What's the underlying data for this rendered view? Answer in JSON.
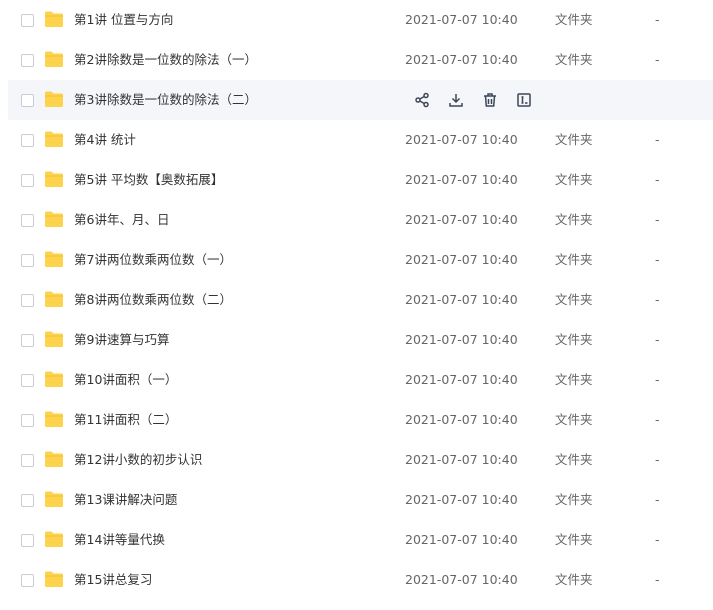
{
  "columns": {
    "type_label": "文件夹",
    "size_label": "-"
  },
  "rows": [
    {
      "name": "第1讲 位置与方向",
      "date": "2021-07-07 10:40"
    },
    {
      "name": "第2讲除数是一位数的除法（一）",
      "date": "2021-07-07 10:40"
    },
    {
      "name": "第3讲除数是一位数的除法（二）",
      "date": "",
      "hovered": true
    },
    {
      "name": "第4讲 统计",
      "date": "2021-07-07 10:40"
    },
    {
      "name": "第5讲 平均数【奥数拓展】",
      "date": "2021-07-07 10:40"
    },
    {
      "name": "第6讲年、月、日",
      "date": "2021-07-07 10:40"
    },
    {
      "name": "第7讲两位数乘两位数（一）",
      "date": "2021-07-07 10:40"
    },
    {
      "name": "第8讲两位数乘两位数（二）",
      "date": "2021-07-07 10:40"
    },
    {
      "name": "第9讲速算与巧算",
      "date": "2021-07-07 10:40"
    },
    {
      "name": "第10讲面积（一）",
      "date": "2021-07-07 10:40"
    },
    {
      "name": "第11讲面积（二）",
      "date": "2021-07-07 10:40"
    },
    {
      "name": "第12讲小数的初步认识",
      "date": "2021-07-07 10:40"
    },
    {
      "name": "第13课讲解决问题",
      "date": "2021-07-07 10:40"
    },
    {
      "name": "第14讲等量代换",
      "date": "2021-07-07 10:40"
    },
    {
      "name": "第15讲总复习",
      "date": "2021-07-07 10:40"
    }
  ],
  "hover_actions": [
    "share-icon",
    "download-icon",
    "delete-icon",
    "rename-icon"
  ],
  "colors": {
    "folder": "#fdd24c",
    "folder_tab": "#f7c02e",
    "icon": "#3d4657",
    "hover_bg": "#f5f6fa"
  }
}
